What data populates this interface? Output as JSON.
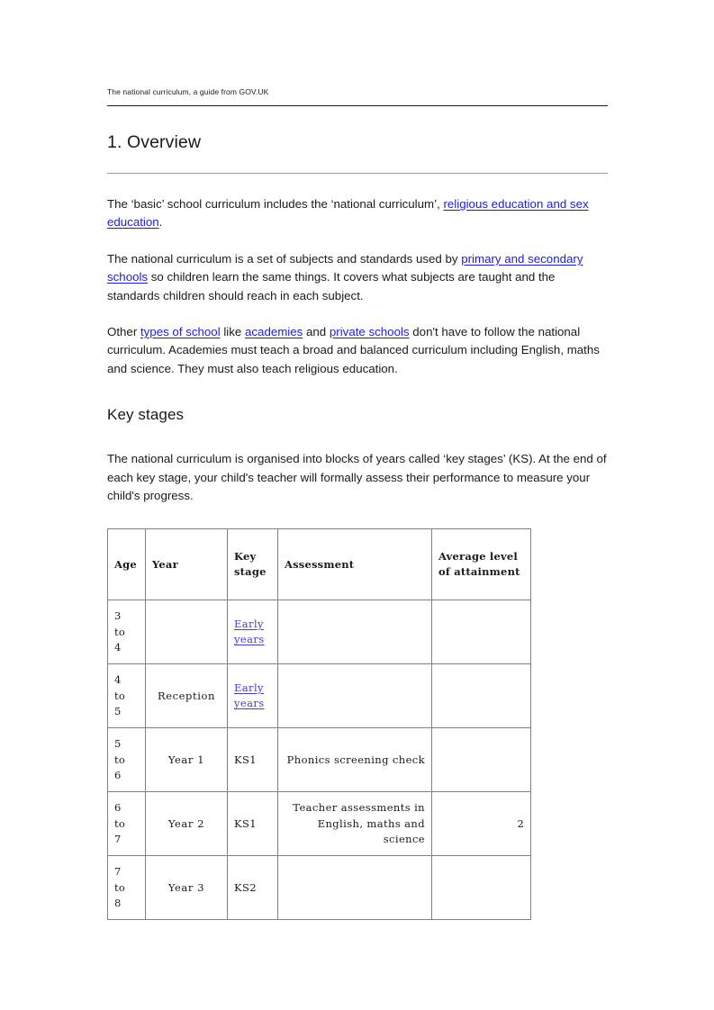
{
  "document": {
    "running_header": "The national curriculum, a guide from GOV.UK",
    "section_heading": "1. Overview",
    "subsection_heading": "Key stages"
  },
  "paragraphs": {
    "p1": {
      "part1": "The ‘basic’ school curriculum includes the ‘national curriculum’, ",
      "link1": "religious education and sex education",
      "part2": "."
    },
    "p2": {
      "part1": "The national curriculum is a set of subjects and standards used by ",
      "link1": "primary and secondary schools",
      "part2": " so children learn the same things. It covers what subjects are taught and the standards children should reach in each subject."
    },
    "p3": {
      "part1": "Other ",
      "link1": "types of school",
      "part2": " like ",
      "link2": "academies",
      "part3": " and ",
      "link3": "private schools",
      "part4": " don't have to follow the national curriculum. Academies must teach a broad and balanced curriculum including English, maths and science. They must also teach religious education."
    },
    "p4": {
      "text": "The national curriculum is organised into blocks of years called ‘key stages’ (KS). At the end of each key stage, your child's teacher will formally assess their performance to measure your child's progress."
    }
  },
  "table": {
    "headers": {
      "age": "Age",
      "year": "Year",
      "key_stage": "Key stage",
      "assessment": "Assessment",
      "average_level": "Average level of attainment"
    },
    "rows": [
      {
        "age_from": "3",
        "age_to_word": "to",
        "age_until": "4",
        "year": "",
        "key_stage": "Early years",
        "key_stage_is_link": true,
        "assessment": "",
        "average_level": ""
      },
      {
        "age_from": "4",
        "age_to_word": "to",
        "age_until": "5",
        "year": "Reception",
        "key_stage": "Early years",
        "key_stage_is_link": true,
        "assessment": "",
        "average_level": ""
      },
      {
        "age_from": "5",
        "age_to_word": "to",
        "age_until": "6",
        "year": "Year 1",
        "key_stage": "KS1",
        "key_stage_is_link": false,
        "assessment": "Phonics screening check",
        "average_level": ""
      },
      {
        "age_from": "6",
        "age_to_word": "to",
        "age_until": "7",
        "year": "Year 2",
        "key_stage": "KS1",
        "key_stage_is_link": false,
        "assessment": "Teacher assessments in English, maths and science",
        "average_level": "2"
      },
      {
        "age_from": "7",
        "age_to_word": "to",
        "age_until": "8",
        "year": "Year 3",
        "key_stage": "KS2",
        "key_stage_is_link": false,
        "assessment": "",
        "average_level": ""
      }
    ]
  },
  "colors": {
    "link": "#1c1ce0",
    "table_link": "#4a3ad0",
    "text": "#1a1a1a",
    "rule_top": "#1c1c1c",
    "rule_sub": "#9a9a9a",
    "table_border": "#808080"
  }
}
